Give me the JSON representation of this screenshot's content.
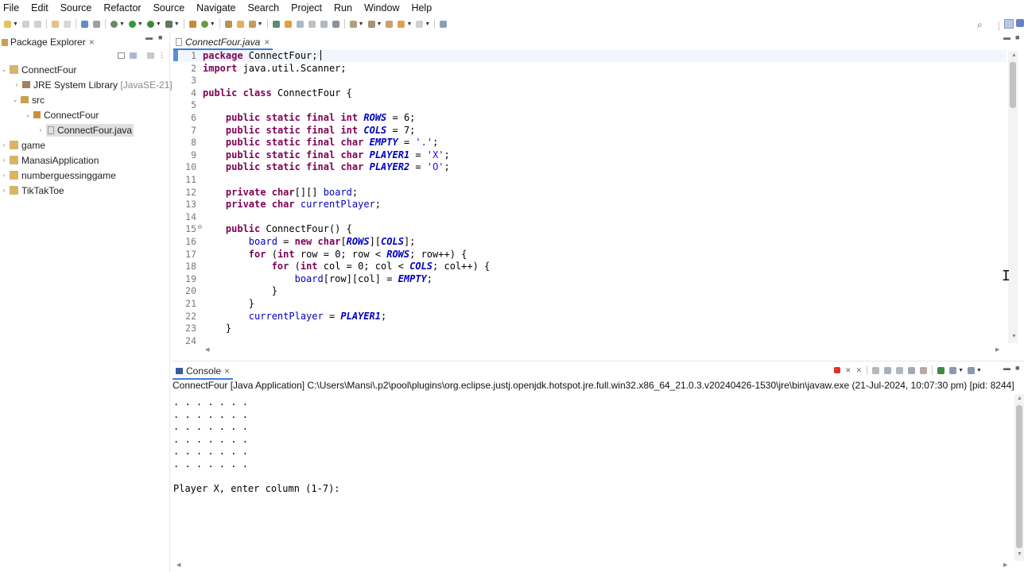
{
  "menu": [
    "File",
    "Edit",
    "Source",
    "Refactor",
    "Source",
    "Navigate",
    "Search",
    "Project",
    "Run",
    "Window",
    "Help"
  ],
  "package_explorer": {
    "title": "Package Explorer",
    "close_glyph": "×",
    "tree": [
      {
        "label": "ConnectFour",
        "twist": "⌄",
        "icon": "project-icon"
      },
      {
        "label": "JRE System Library",
        "extra": "[JavaSE-21]",
        "twist": "›",
        "icon": "library-icon"
      },
      {
        "label": "src",
        "twist": "⌄",
        "icon": "source-folder-icon"
      },
      {
        "label": "ConnectFour",
        "twist": "⌄",
        "icon": "package-icon"
      },
      {
        "label": "ConnectFour.java",
        "twist": "›",
        "icon": "java-file-icon",
        "selected": true
      },
      {
        "label": "game",
        "twist": "›",
        "icon": "project-icon"
      },
      {
        "label": "ManasiApplication",
        "twist": "›",
        "icon": "project-icon"
      },
      {
        "label": "numberguessinggame",
        "twist": "›",
        "icon": "project-icon"
      },
      {
        "label": "TikTakToe",
        "twist": "›",
        "icon": "project-icon"
      }
    ]
  },
  "editor": {
    "tab_label": "ConnectFour.java",
    "close_glyph": "×",
    "lines": [
      {
        "n": "1",
        "t": "package ConnectFour;"
      },
      {
        "n": "2",
        "t": "import java.util.Scanner;"
      },
      {
        "n": "3",
        "t": ""
      },
      {
        "n": "4",
        "t": "public class ConnectFour {"
      },
      {
        "n": "5",
        "t": ""
      },
      {
        "n": "6",
        "t": "    public static final int ROWS = 6;"
      },
      {
        "n": "7",
        "t": "    public static final int COLS = 7;"
      },
      {
        "n": "8",
        "t": "    public static final char EMPTY = '.';"
      },
      {
        "n": "9",
        "t": "    public static final char PLAYER1 = 'X';"
      },
      {
        "n": "10",
        "t": "    public static final char PLAYER2 = 'O';"
      },
      {
        "n": "11",
        "t": ""
      },
      {
        "n": "12",
        "t": "    private char[][] board;"
      },
      {
        "n": "13",
        "t": "    private char currentPlayer;"
      },
      {
        "n": "14",
        "t": ""
      },
      {
        "n": "15",
        "t": "    public ConnectFour() {"
      },
      {
        "n": "16",
        "t": "        board = new char[ROWS][COLS];"
      },
      {
        "n": "17",
        "t": "        for (int row = 0; row < ROWS; row++) {"
      },
      {
        "n": "18",
        "t": "            for (int col = 0; col < COLS; col++) {"
      },
      {
        "n": "19",
        "t": "                board[row][col] = EMPTY;"
      },
      {
        "n": "20",
        "t": "            }"
      },
      {
        "n": "21",
        "t": "        }"
      },
      {
        "n": "22",
        "t": "        currentPlayer = PLAYER1;"
      },
      {
        "n": "23",
        "t": "    }"
      },
      {
        "n": "24",
        "t": ""
      }
    ]
  },
  "console": {
    "tab_label": "Console",
    "close_glyph": "×",
    "header": "ConnectFour [Java Application] C:\\Users\\Mansi\\.p2\\pool\\plugins\\org.eclipse.justj.openjdk.hotspot.jre.full.win32.x86_64_21.0.3.v20240426-1530\\jre\\bin\\javaw.exe  (21-Jul-2024, 10:07:30 pm) [pid: 8244]",
    "output": [
      ". . . . . . .",
      ". . . . . . .",
      ". . . . . . .",
      ". . . . . . .",
      ". . . . . . .",
      ". . . . . . .",
      "",
      "Player X, enter column (1-7):"
    ]
  },
  "colors": {
    "keyword": "#7f0055",
    "field": "#0000c0",
    "string": "#2a00ff",
    "tab_underline": "#3d7cd8",
    "terminate": "#e03030"
  }
}
